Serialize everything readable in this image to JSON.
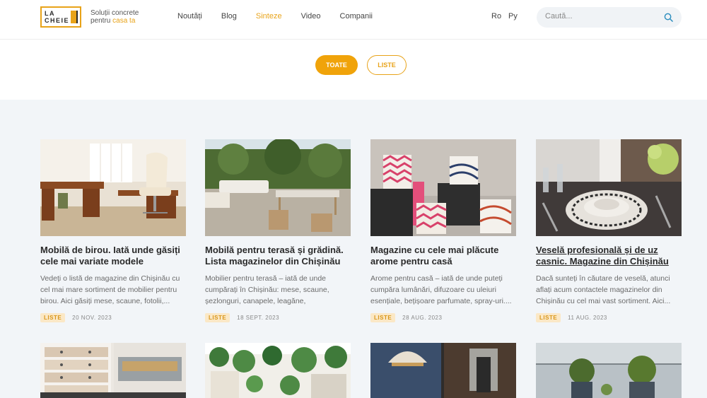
{
  "brand": {
    "logo_line1": "LA",
    "logo_line2": "CHEIE",
    "tagline_line1": "Soluții concrete",
    "tagline_line2_prefix": "pentru",
    "tagline_line2_accent": "casa ta"
  },
  "nav": [
    "Noutăți",
    "Blog",
    "Sinteze",
    "Video",
    "Companii"
  ],
  "nav_active": "Sinteze",
  "languages": [
    "Ro",
    "Ру"
  ],
  "search": {
    "placeholder": "Caută..."
  },
  "filters": [
    "TOATE",
    "LISTE"
  ],
  "filters_active": "TOATE",
  "colors": {
    "accent": "#e8a319",
    "badge_bg": "#fbe8c6",
    "content_bg": "#f2f5f8"
  },
  "cards": [
    {
      "title": "Mobilă de birou. Iată unde găsiți cele mai variate modele",
      "excerpt": "Vedeți o listă de magazine din Chișinău cu cel mai mare sortiment de mobilier pentru birou. Aici găsiți mese, scaune, fotolii,...",
      "tag": "LISTE",
      "date": "20 NOV. 2023",
      "image": "office-furniture-photo"
    },
    {
      "title": "Mobilă pentru terasă și grădină. Lista magazinelor din Chișinău",
      "excerpt": "Mobilier pentru terasă – iată de unde cumpărați în Chișinău: mese, scaune, șezlonguri, canapele, leagăne, balansoare,...",
      "tag": "LISTE",
      "date": "18 SEPT. 2023",
      "image": "terrace-furniture-photo"
    },
    {
      "title": "Magazine cu cele mai plăcute arome pentru casă",
      "excerpt": "Arome pentru casă – iată de unde puteți cumpăra lumânări, difuzoare cu uleiuri esențiale, bețișoare parfumate, spray-uri....",
      "tag": "LISTE",
      "date": "28 AUG. 2023",
      "image": "scented-candles-photo"
    },
    {
      "title": "Veselă profesională și de uz casnic. Magazine din Chișinău",
      "excerpt": "Dacă sunteți în căutare de veselă, atunci aflați acum contactele magazinelor din Chișinău cu cel mai vast sortiment. Aici...",
      "tag": "LISTE",
      "date": "11 AUG. 2023",
      "image": "tableware-photo"
    }
  ],
  "cards_row2": [
    {
      "image": "storage-boxes-photo"
    },
    {
      "image": "hanging-plants-photo"
    },
    {
      "image": "pendant-lamp-interior-photo"
    },
    {
      "image": "potted-plants-balcony-photo"
    }
  ]
}
